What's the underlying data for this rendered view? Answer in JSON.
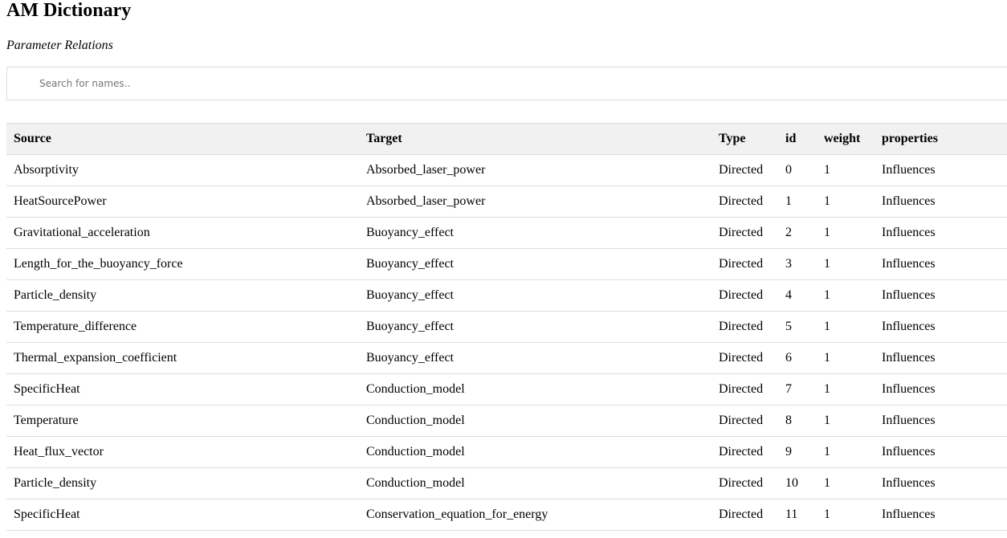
{
  "app": {
    "title": "AM Dictionary",
    "subtitle": "Parameter Relations"
  },
  "search": {
    "placeholder": "Search for names..",
    "value": ""
  },
  "table": {
    "headers": {
      "source": "Source",
      "target": "Target",
      "type": "Type",
      "id": "id",
      "weight": "weight",
      "properties": "properties"
    },
    "rows": [
      {
        "source": "Absorptivity",
        "target": "Absorbed_laser_power",
        "type": "Directed",
        "id": "0",
        "weight": "1",
        "properties": "Influences"
      },
      {
        "source": "HeatSourcePower",
        "target": "Absorbed_laser_power",
        "type": "Directed",
        "id": "1",
        "weight": "1",
        "properties": "Influences"
      },
      {
        "source": "Gravitational_acceleration",
        "target": "Buoyancy_effect",
        "type": "Directed",
        "id": "2",
        "weight": "1",
        "properties": "Influences"
      },
      {
        "source": "Length_for_the_buoyancy_force",
        "target": "Buoyancy_effect",
        "type": "Directed",
        "id": "3",
        "weight": "1",
        "properties": "Influences"
      },
      {
        "source": "Particle_density",
        "target": "Buoyancy_effect",
        "type": "Directed",
        "id": "4",
        "weight": "1",
        "properties": "Influences"
      },
      {
        "source": "Temperature_difference",
        "target": "Buoyancy_effect",
        "type": "Directed",
        "id": "5",
        "weight": "1",
        "properties": "Influences"
      },
      {
        "source": "Thermal_expansion_coefficient",
        "target": "Buoyancy_effect",
        "type": "Directed",
        "id": "6",
        "weight": "1",
        "properties": "Influences"
      },
      {
        "source": "SpecificHeat",
        "target": "Conduction_model",
        "type": "Directed",
        "id": "7",
        "weight": "1",
        "properties": "Influences"
      },
      {
        "source": "Temperature",
        "target": "Conduction_model",
        "type": "Directed",
        "id": "8",
        "weight": "1",
        "properties": "Influences"
      },
      {
        "source": "Heat_flux_vector",
        "target": "Conduction_model",
        "type": "Directed",
        "id": "9",
        "weight": "1",
        "properties": "Influences"
      },
      {
        "source": "Particle_density",
        "target": "Conduction_model",
        "type": "Directed",
        "id": "10",
        "weight": "1",
        "properties": "Influences"
      },
      {
        "source": "SpecificHeat",
        "target": "Conservation_equation_for_energy",
        "type": "Directed",
        "id": "11",
        "weight": "1",
        "properties": "Influences"
      }
    ]
  }
}
